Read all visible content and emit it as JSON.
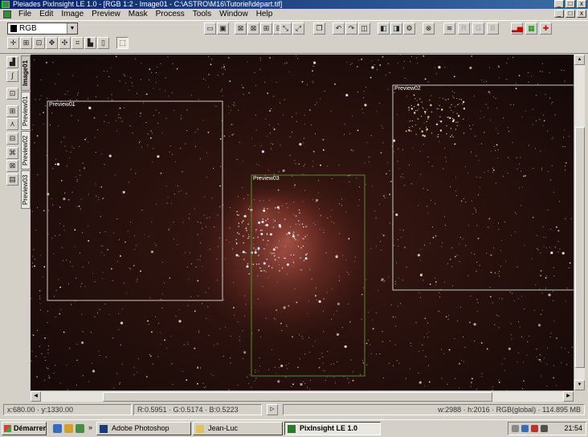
{
  "window": {
    "title": "Pleiades PixInsight LE 1.0 - [RGB 1:2 - Image01 - C:\\ASTRO\\M16\\Tutoriel\\départ.tif]",
    "controls": [
      "_",
      "□",
      "x"
    ]
  },
  "menu": {
    "items": [
      "File",
      "Edit",
      "Image",
      "Preview",
      "Mask",
      "Process",
      "Tools",
      "Window",
      "Help"
    ],
    "controls": [
      "_",
      "□",
      "x"
    ]
  },
  "toolbar": {
    "color_mode": "RGB",
    "disabled_labels": [
      "R",
      "G",
      "B"
    ]
  },
  "tabs": [
    "Image01",
    "Preview01",
    "Preview02",
    "Preview03"
  ],
  "previews": [
    "Preview01",
    "Preview02",
    "Preview03"
  ],
  "colors": {
    "preview_frame": "#c8c8c8",
    "active_preview_frame": "#5a8a2a",
    "sky": "#150a08",
    "nebula": "#a04a3a"
  },
  "status": {
    "coords": "x:680.00 · y:1330.00",
    "rgb_values": "R:0.5951 · G:0.5174 · B:0.5223",
    "image_info": "w:2988 · h:2016 · RGB(global) · 114.895 MB"
  },
  "taskbar": {
    "start": "Démarrer",
    "tasks": [
      "Adobe Photoshop",
      "Jean-Luc",
      "PixInsight LE 1.0"
    ],
    "clock": "21:54"
  }
}
